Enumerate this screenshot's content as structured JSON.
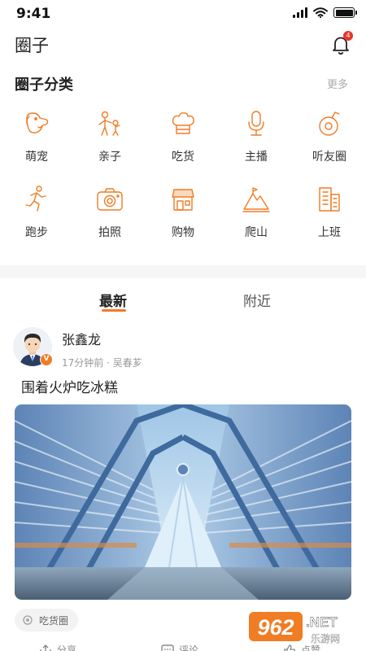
{
  "status_bar": {
    "time": "9:41"
  },
  "header": {
    "title": "圈子",
    "notification_count": "4"
  },
  "categories_section": {
    "title": "圈子分类",
    "more_label": "更多",
    "items": [
      {
        "label": "萌宠",
        "icon": "dog-icon"
      },
      {
        "label": "亲子",
        "icon": "parent-child-icon"
      },
      {
        "label": "吃货",
        "icon": "chef-hat-icon"
      },
      {
        "label": "主播",
        "icon": "microphone-icon"
      },
      {
        "label": "听友圈",
        "icon": "music-disc-icon"
      },
      {
        "label": "跑步",
        "icon": "runner-icon"
      },
      {
        "label": "拍照",
        "icon": "camera-icon"
      },
      {
        "label": "购物",
        "icon": "shop-icon"
      },
      {
        "label": "爬山",
        "icon": "mountain-icon"
      },
      {
        "label": "上班",
        "icon": "office-building-icon"
      }
    ]
  },
  "tabs": [
    {
      "label": "最新",
      "active": true
    },
    {
      "label": "附近",
      "active": false
    }
  ],
  "post": {
    "author": "张鑫龙",
    "time": "17分钟前",
    "location": "吴春芗",
    "text": "围着火炉吃冰糕",
    "tag": "吃货圈",
    "actions": {
      "share": "分享",
      "comment": "评论",
      "like": "点赞"
    }
  },
  "watermark": {
    "number": "962",
    "suffix": ".NET",
    "sub": "乐游网"
  },
  "colors": {
    "accent": "#f07c24",
    "badge": "#e8332f"
  }
}
